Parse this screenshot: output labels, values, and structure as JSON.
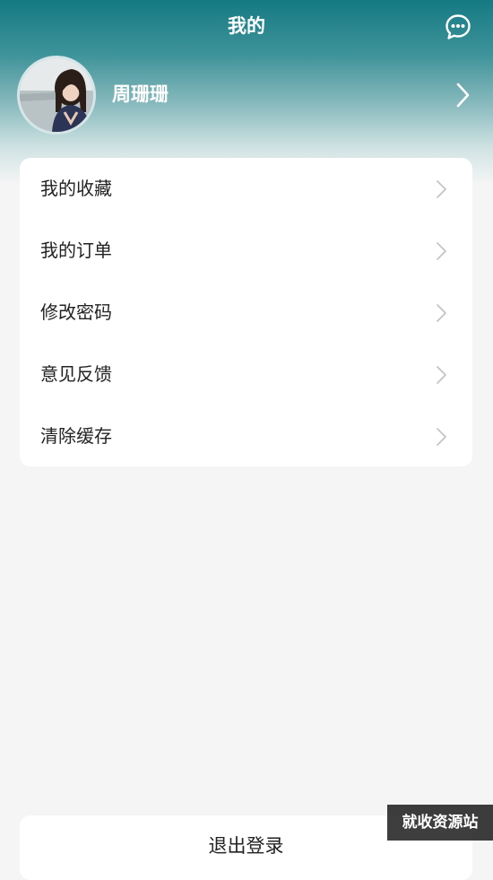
{
  "header": {
    "title": "我的",
    "message_icon": "chat-bubble-icon"
  },
  "profile": {
    "name": "周珊珊",
    "chevron_icon": "chevron-right-icon"
  },
  "menu": {
    "items": [
      {
        "label": "我的收藏"
      },
      {
        "label": "我的订单"
      },
      {
        "label": "修改密码"
      },
      {
        "label": "意见反馈"
      },
      {
        "label": "清除缓存"
      }
    ]
  },
  "logout_label": "退出登录",
  "watermark": "就收资源站",
  "colors": {
    "header_top": "#157a83",
    "page_bg": "#f5f5f5",
    "card_bg": "#ffffff",
    "text": "#222222",
    "chevron": "#c4c4c4"
  }
}
